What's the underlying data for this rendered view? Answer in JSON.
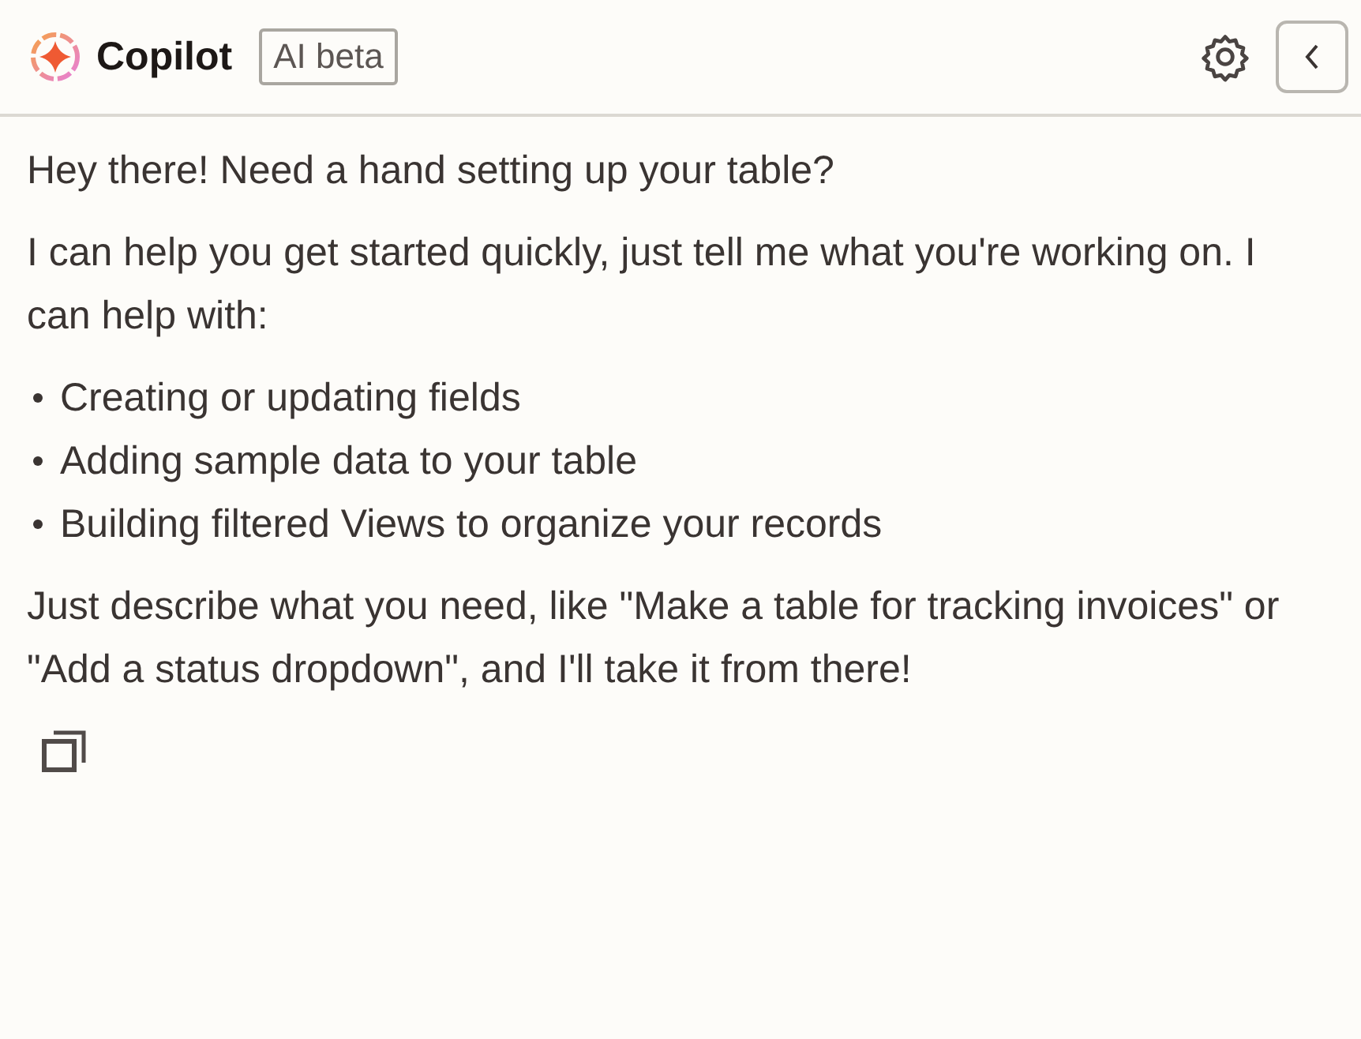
{
  "header": {
    "title": "Copilot",
    "badge": "AI beta"
  },
  "message": {
    "paragraphs": [
      "Hey there! Need a hand setting up your table?",
      "I can help you get started quickly, just tell me what you're working on. I can help with:"
    ],
    "bullets": [
      "Creating or updating fields",
      "Adding sample data to your table",
      "Building filtered Views to organize your records"
    ],
    "closing": "Just describe what you need, like \"Make a table for tracking invoices\" or \"Add a status dropdown\", and I'll take it from there!"
  }
}
